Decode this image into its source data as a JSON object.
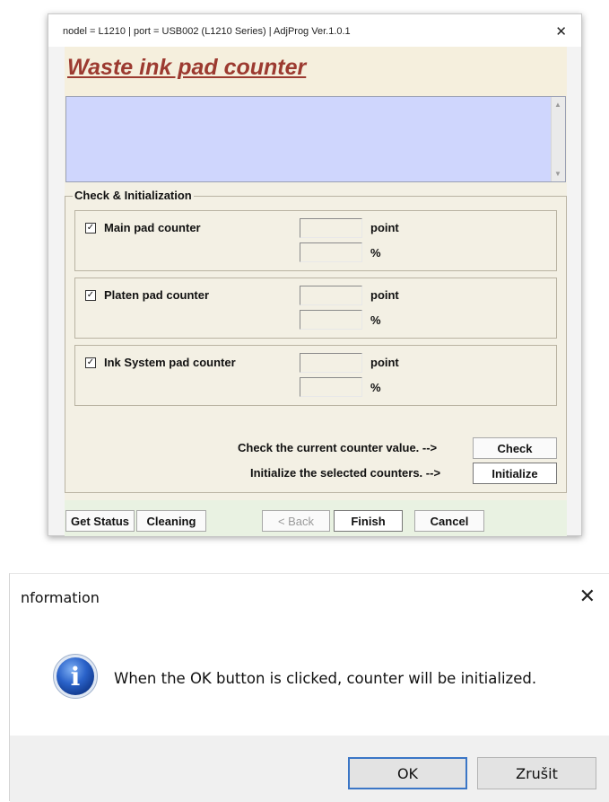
{
  "adjprog": {
    "title": "nodel = L1210 | port = USB002 (L1210 Series) | AdjProg Ver.1.0.1",
    "heading": "Waste ink pad counter",
    "group_label": "Check & Initialization",
    "counters": [
      {
        "label": "Main pad counter",
        "checked": "☑",
        "unit_point": "point",
        "unit_percent": "%",
        "point_value": "",
        "percent_value": ""
      },
      {
        "label": "Platen pad counter",
        "checked": "☑",
        "unit_point": "point",
        "unit_percent": "%",
        "point_value": "",
        "percent_value": ""
      },
      {
        "label": "Ink System pad counter",
        "checked": "☑",
        "unit_point": "point",
        "unit_percent": "%",
        "point_value": "",
        "percent_value": ""
      }
    ],
    "check_text": "Check the current counter value. -->",
    "check_button": "Check",
    "initialize_text": "Initialize the selected counters. -->",
    "initialize_button": "Initialize",
    "buttons": {
      "get_status": "Get Status",
      "cleaning": "Cleaning",
      "back": "< Back",
      "finish": "Finish",
      "cancel": "Cancel"
    },
    "close_glyph": "✕",
    "scroll_up": "▲",
    "scroll_down": "▼",
    "check_mark": "✓"
  },
  "info_dialog": {
    "title": "nformation",
    "message": "When the OK button is clicked, counter will be initialized.",
    "ok_button": "OK",
    "cancel_button": "Zrušit",
    "close_glyph": "✕",
    "icon": "info-icon",
    "icon_glyph": "i"
  },
  "colors": {
    "heading": "#9c3a30",
    "textbox": "#cfd6fd",
    "info_blue": "#2a62c9",
    "default_button_border": "#3b76c6"
  }
}
